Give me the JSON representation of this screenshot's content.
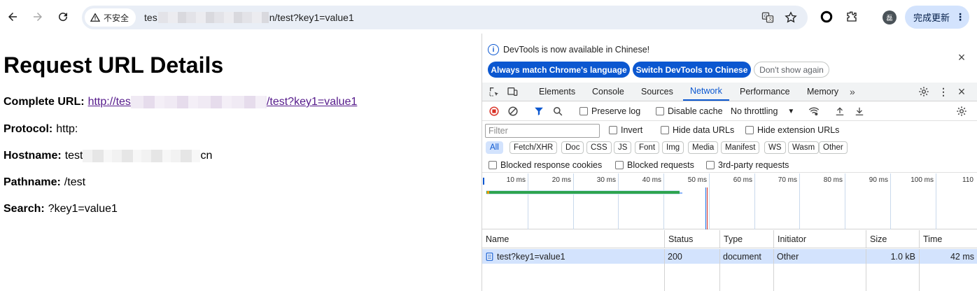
{
  "browser": {
    "security_label": "不安全",
    "url_prefix": "tes",
    "url_suffix": "n/test?key1=value1",
    "avatar_letter": "磊",
    "update_button": "完成更新"
  },
  "page": {
    "title": "Request URL Details",
    "complete_url_label": "Complete URL:",
    "complete_url_prefix": "http://tes",
    "complete_url_suffix": "/test?key1=value1",
    "protocol_label": "Protocol:",
    "protocol_value": "http:",
    "hostname_label": "Hostname:",
    "hostname_prefix": "test",
    "hostname_suffix": "cn",
    "pathname_label": "Pathname:",
    "pathname_value": "/test",
    "search_label": "Search:",
    "search_value": "?key1=value1"
  },
  "devtools": {
    "infobar": {
      "message": "DevTools is now available in Chinese!",
      "btn_match": "Always match Chrome's language",
      "btn_switch": "Switch DevTools to Chinese",
      "btn_dont_show": "Don't show again"
    },
    "tabs": [
      "Elements",
      "Console",
      "Sources",
      "Network",
      "Performance",
      "Memory"
    ],
    "active_tab": "Network",
    "network_toolbar": {
      "preserve_log": "Preserve log",
      "disable_cache": "Disable cache",
      "throttling": "No throttling"
    },
    "filter": {
      "placeholder": "Filter",
      "invert": "Invert",
      "hide_data_urls": "Hide data URLs",
      "hide_extension_urls": "Hide extension URLs"
    },
    "types": [
      "All",
      "Fetch/XHR",
      "Doc",
      "CSS",
      "JS",
      "Font",
      "Img",
      "Media",
      "Manifest",
      "WS",
      "Wasm",
      "Other"
    ],
    "active_type": "All",
    "blocked": {
      "response_cookies": "Blocked response cookies",
      "requests": "Blocked requests",
      "third_party": "3rd-party requests"
    },
    "timeline_ticks": [
      "10 ms",
      "20 ms",
      "30 ms",
      "40 ms",
      "50 ms",
      "60 ms",
      "70 ms",
      "80 ms",
      "90 ms",
      "100 ms",
      "110"
    ],
    "table": {
      "headers": [
        "Name",
        "Status",
        "Type",
        "Initiator",
        "Size",
        "Time"
      ],
      "rows": [
        {
          "name": "test?key1=value1",
          "status": "200",
          "type": "document",
          "initiator": "Other",
          "size": "1.0 kB",
          "time": "42 ms"
        }
      ]
    },
    "colors": {
      "accent": "#0b57d0",
      "selected_row": "#d3e3fd",
      "waterfall_bar": "#2ea44f"
    }
  }
}
